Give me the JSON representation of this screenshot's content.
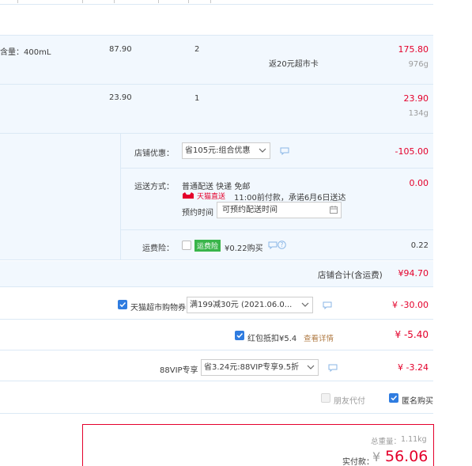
{
  "items": [
    {
      "spec": "含量：400mL",
      "price": "87.90",
      "qty": "2",
      "promo": "返20元超市卡",
      "total": "175.80",
      "weight": "976g"
    },
    {
      "spec": "",
      "price": "23.90",
      "qty": "1",
      "promo": "",
      "total": "23.90",
      "weight": "134g"
    }
  ],
  "shop": {
    "discount_label": "店铺优惠：",
    "discount_select": "省105元:组合优惠",
    "discount_amount": "-105.00",
    "shipping_label": "运送方式：",
    "shipping_method": "普通配送 快递 免邮",
    "tmall_badge": "天猫直送",
    "shipping_promise": "11:00前付款，承诺6月6日送达",
    "schedule_label": "预约时间",
    "schedule_placeholder": "可预约配送时间",
    "shipping_amount": "0.00",
    "insurance_label": "运费险：",
    "insurance_badge": "运费险",
    "insurance_text": "¥0.22购买",
    "insurance_amount": "0.22",
    "subtotal_label": "店铺合计(含运费)",
    "subtotal_value": "¥94.70"
  },
  "coupons": {
    "tmall_label": "天猫超市购物券",
    "tmall_select": "满199减30元 (2021.06.0...",
    "tmall_amount": "¥ -30.00",
    "redpacket_label": "红包抵扣¥5.4",
    "redpacket_link": "查看详情",
    "redpacket_amount": "¥ -5.40",
    "vip_label": "88VIP专享",
    "vip_select": "省3.24元:88VIP专享9.5折",
    "vip_amount": "¥ -3.24"
  },
  "options": {
    "friend_pay": "朋友代付",
    "anonymous": "匿名购买"
  },
  "summary": {
    "weight_label": "总重量：",
    "weight_value": "1.11kg",
    "pay_label": "实付款：",
    "currency": "¥",
    "pay_value": "56.06"
  },
  "colors": {
    "accent": "#e4002b",
    "panel_bg": "#f2f8fe",
    "checkbox": "#2f7ce0",
    "insurance_green": "#39b54a"
  }
}
